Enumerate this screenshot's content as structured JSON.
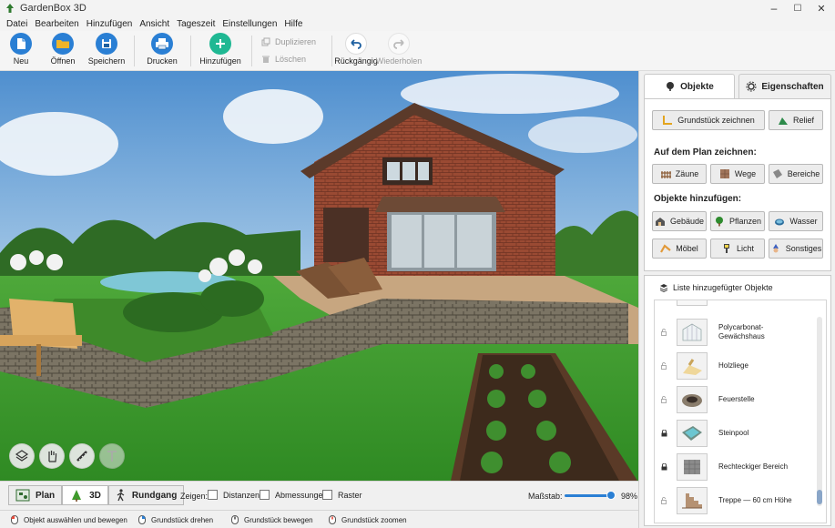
{
  "window": {
    "title": "GardenBox 3D",
    "minimize": "–",
    "maximize": "☐",
    "close": "✕"
  },
  "menu": [
    "Datei",
    "Bearbeiten",
    "Hinzufügen",
    "Ansicht",
    "Tageszeit",
    "Einstellungen",
    "Hilfe"
  ],
  "toolbar": {
    "new": "Neu",
    "open": "Öffnen",
    "save": "Speichern",
    "print": "Drucken",
    "add": "Hinzufügen",
    "duplicate": "Duplizieren",
    "delete": "Löschen",
    "undo": "Rückgängig",
    "redo": "Wiederholen"
  },
  "panel": {
    "tab_objects": "Objekte",
    "tab_properties": "Eigenschaften",
    "draw_plot": "Grundstück zeichnen",
    "relief": "Relief",
    "draw_on_plan_label": "Auf dem Plan zeichnen:",
    "fences": "Zäune",
    "paths": "Wege",
    "areas": "Bereiche",
    "add_objects_label": "Objekte hinzufügen:",
    "buildings": "Gebäude",
    "plants": "Pflanzen",
    "water": "Wasser",
    "furniture": "Möbel",
    "light": "Licht",
    "other": "Sonstiges",
    "list_title": "Liste hinzugefügter Objekte",
    "objects": [
      {
        "name": "Polycarbonat-Gewächshaus",
        "locked": false
      },
      {
        "name": "Holzliege",
        "locked": false
      },
      {
        "name": "Feuerstelle",
        "locked": false
      },
      {
        "name": "Steinpool",
        "locked": true
      },
      {
        "name": "Rechteckiger Bereich",
        "locked": true
      },
      {
        "name": "Treppe — 60 cm Höhe",
        "locked": false
      }
    ]
  },
  "bottom": {
    "plan": "Plan",
    "view3d": "3D",
    "walkthrough": "Rundgang",
    "show_label": "Zeigen:",
    "distances": "Distanzen",
    "dimensions": "Abmessungen",
    "grid": "Raster",
    "scale_label": "Maßstab:",
    "scale_value": "98%",
    "scale_fraction": 0.98
  },
  "status": {
    "select": "Objekt auswählen und bewegen",
    "rotate": "Grundstück drehen",
    "move": "Grundstück bewegen",
    "zoom": "Grundstück zoomen"
  },
  "colors": {
    "accent": "#2a7fd4",
    "add_button": "#1fb893",
    "folder": "#f0b429",
    "sky": "#6aa3d8",
    "grass": "#3f9a2c"
  }
}
